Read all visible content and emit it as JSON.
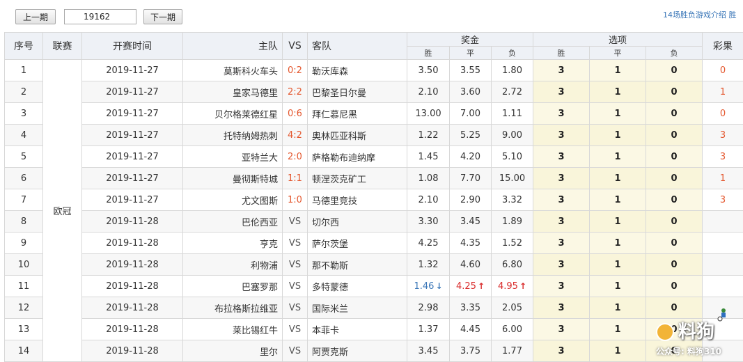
{
  "toolbar": {
    "prev_label": "上一期",
    "period_value": "19162",
    "next_label": "下一期",
    "rules_link": "14场胜负游戏介绍 胜"
  },
  "headers": {
    "seq": "序号",
    "league": "联赛",
    "time": "开赛时间",
    "home": "主队",
    "vs": "VS",
    "away": "客队",
    "bonus": "奖金",
    "options": "选项",
    "result": "彩果",
    "win": "胜",
    "draw": "平",
    "lose": "负"
  },
  "rows": [
    {
      "seq": "1",
      "league": "欧冠",
      "time": "2019-11-27",
      "home": "莫斯科火车头",
      "score": "0:2",
      "away": "勒沃库森",
      "w": "3.50",
      "d": "3.55",
      "l": "1.80",
      "ow": "3",
      "od": "1",
      "ol": "0",
      "result": "0"
    },
    {
      "seq": "2",
      "time": "2019-11-27",
      "home": "皇家马德里",
      "score": "2:2",
      "away": "巴黎圣日尔曼",
      "w": "2.10",
      "d": "3.60",
      "l": "2.72",
      "ow": "3",
      "od": "1",
      "ol": "0",
      "result": "1"
    },
    {
      "seq": "3",
      "time": "2019-11-27",
      "home": "贝尔格莱德红星",
      "score": "0:6",
      "away": "拜仁慕尼黑",
      "w": "13.00",
      "d": "7.00",
      "l": "1.11",
      "ow": "3",
      "od": "1",
      "ol": "0",
      "result": "0"
    },
    {
      "seq": "4",
      "time": "2019-11-27",
      "home": "托特纳姆热刺",
      "score": "4:2",
      "away": "奥林匹亚科斯",
      "w": "1.22",
      "d": "5.25",
      "l": "9.00",
      "ow": "3",
      "od": "1",
      "ol": "0",
      "result": "3"
    },
    {
      "seq": "5",
      "time": "2019-11-27",
      "home": "亚特兰大",
      "score": "2:0",
      "away": "萨格勒布迪纳摩",
      "w": "1.45",
      "d": "4.20",
      "l": "5.10",
      "ow": "3",
      "od": "1",
      "ol": "0",
      "result": "3"
    },
    {
      "seq": "6",
      "time": "2019-11-27",
      "home": "曼彻斯特城",
      "score": "1:1",
      "away": "顿涅茨克矿工",
      "w": "1.08",
      "d": "7.70",
      "l": "15.00",
      "ow": "3",
      "od": "1",
      "ol": "0",
      "result": "1"
    },
    {
      "seq": "7",
      "time": "2019-11-27",
      "home": "尤文图斯",
      "score": "1:0",
      "away": "马德里竞技",
      "w": "2.10",
      "d": "2.90",
      "l": "3.32",
      "ow": "3",
      "od": "1",
      "ol": "0",
      "result": "3"
    },
    {
      "seq": "8",
      "time": "2019-11-28",
      "home": "巴伦西亚",
      "score": "VS",
      "away": "切尔西",
      "w": "3.30",
      "d": "3.45",
      "l": "1.89",
      "ow": "3",
      "od": "1",
      "ol": "0",
      "result": ""
    },
    {
      "seq": "9",
      "time": "2019-11-28",
      "home": "亨克",
      "score": "VS",
      "away": "萨尔茨堡",
      "w": "4.25",
      "d": "4.35",
      "l": "1.52",
      "ow": "3",
      "od": "1",
      "ol": "0",
      "result": ""
    },
    {
      "seq": "10",
      "time": "2019-11-28",
      "home": "利物浦",
      "score": "VS",
      "away": "那不勒斯",
      "w": "1.32",
      "d": "4.60",
      "l": "6.80",
      "ow": "3",
      "od": "1",
      "ol": "0",
      "result": ""
    },
    {
      "seq": "11",
      "time": "2019-11-28",
      "home": "巴塞罗那",
      "score": "VS",
      "away": "多特蒙德",
      "w": "1.46",
      "wt": "down",
      "d": "4.25",
      "dt": "up",
      "l": "4.95",
      "lt": "up",
      "ow": "3",
      "od": "1",
      "ol": "0",
      "result": ""
    },
    {
      "seq": "12",
      "time": "2019-11-28",
      "home": "布拉格斯拉维亚",
      "score": "VS",
      "away": "国际米兰",
      "w": "2.98",
      "d": "3.35",
      "l": "2.05",
      "ow": "3",
      "od": "1",
      "ol": "0",
      "result": ""
    },
    {
      "seq": "13",
      "time": "2019-11-28",
      "home": "莱比锡红牛",
      "score": "VS",
      "away": "本菲卡",
      "w": "1.37",
      "d": "4.45",
      "l": "6.00",
      "ow": "3",
      "od": "1",
      "ol": "0",
      "result": ""
    },
    {
      "seq": "14",
      "time": "2019-11-28",
      "home": "里尔",
      "score": "VS",
      "away": "阿贾克斯",
      "w": "3.45",
      "d": "3.75",
      "l": "1.77",
      "ow": "3",
      "od": "1",
      "ol": "0",
      "result": ""
    }
  ],
  "league_name": "欧冠",
  "watermark": {
    "title": "料狗",
    "subtitle": "公众号: 料狗310"
  },
  "colors": {
    "accent_red": "#e4572e",
    "link_blue": "#3b77b8",
    "header_bg": "#eef1f6",
    "option_bg": "#fbf8e4"
  }
}
